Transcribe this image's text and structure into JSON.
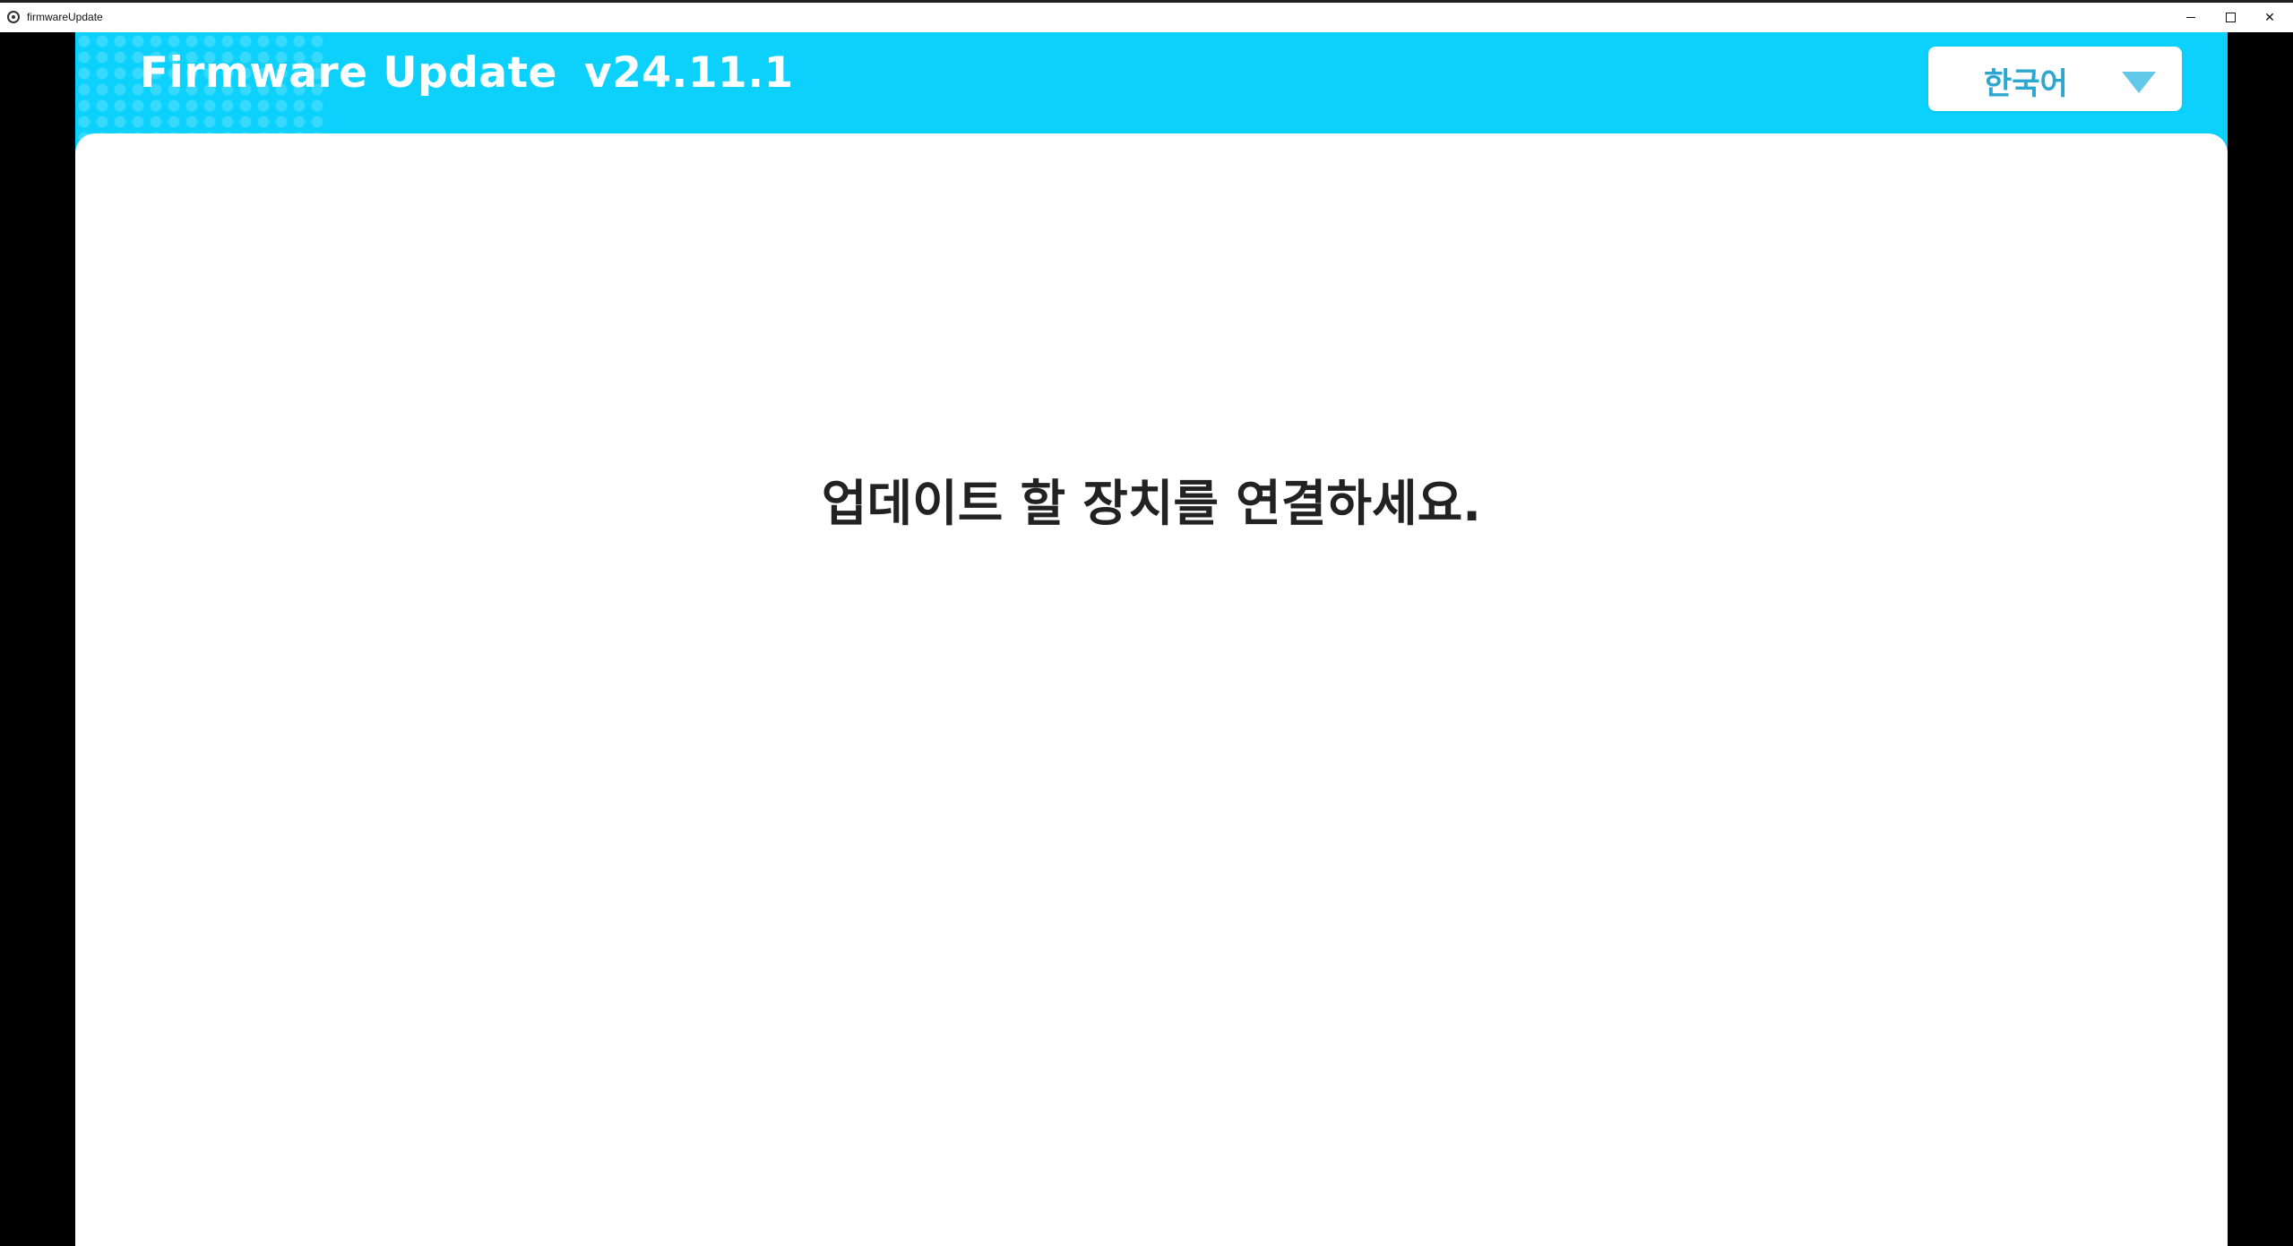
{
  "window": {
    "title": "firmwareUpdate",
    "controls": {
      "minimize_glyph": "—",
      "maximize_glyph": "□",
      "close_glyph": "✕"
    }
  },
  "header": {
    "title": "Firmware Update",
    "version": "v24.11.1",
    "background_color": "#0bd1fc"
  },
  "language_select": {
    "selected": "한국어",
    "icon": "triangle-down-icon"
  },
  "main": {
    "message": "업데이트 할 장치를 연결하세요."
  }
}
